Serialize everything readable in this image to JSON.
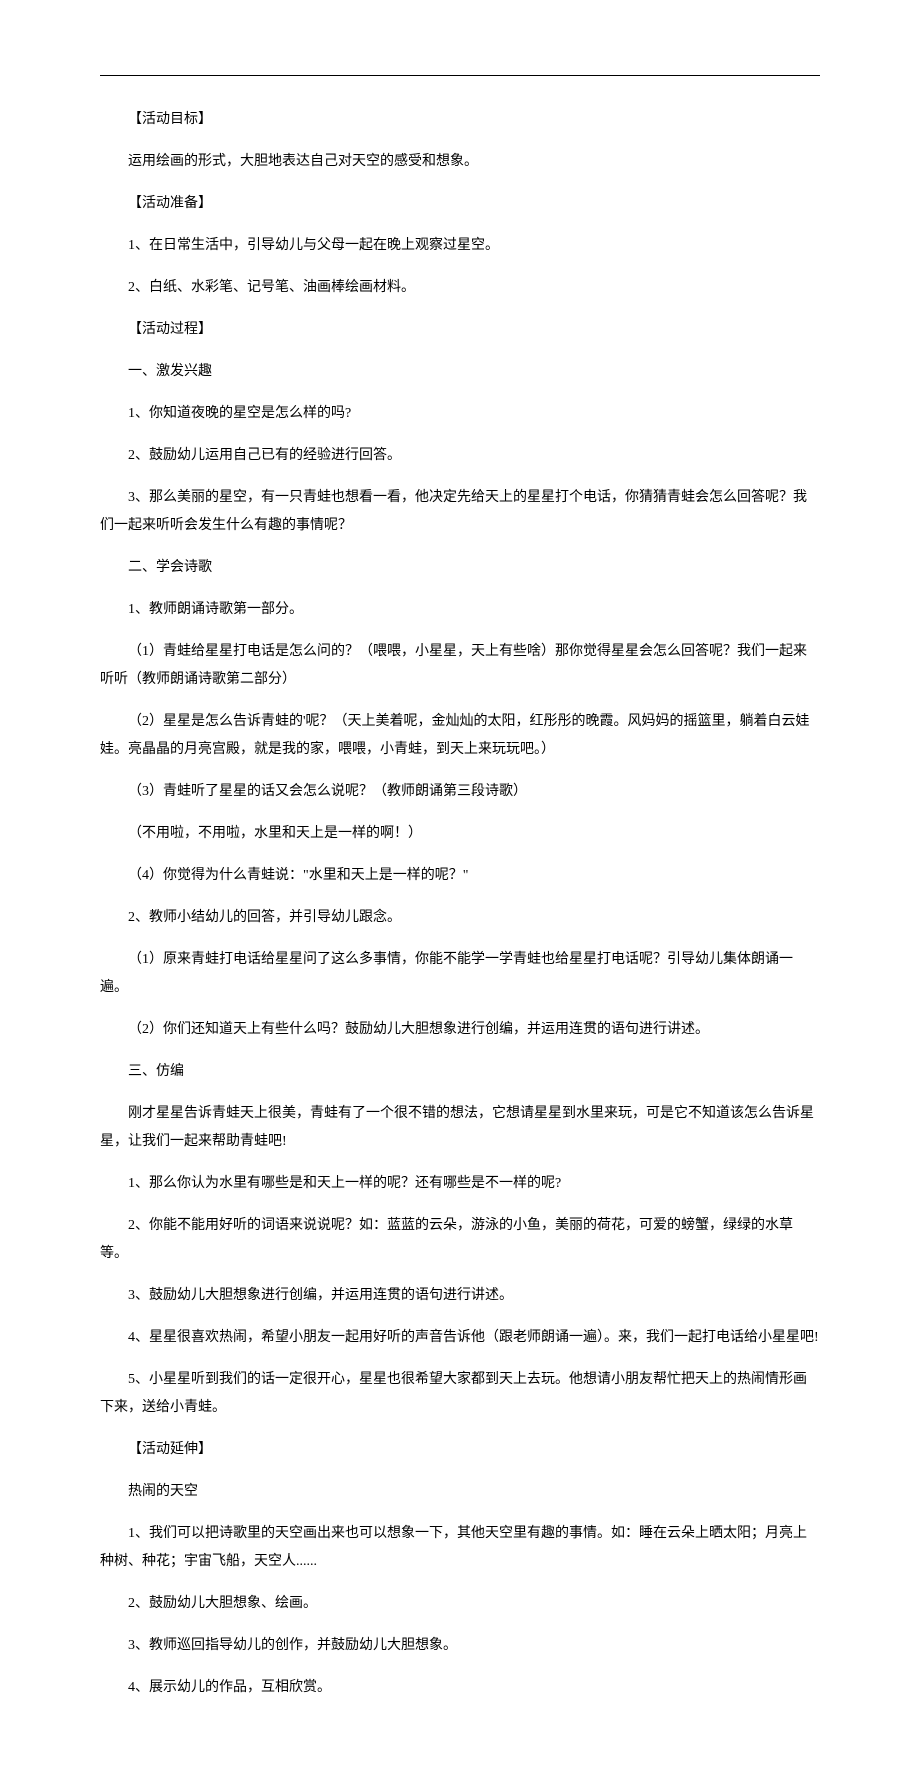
{
  "lines": [
    "【活动目标】",
    "运用绘画的形式，大胆地表达自己对天空的感受和想象。",
    "【活动准备】",
    "1、在日常生活中，引导幼儿与父母一起在晚上观察过星空。",
    "2、白纸、水彩笔、记号笔、油画棒绘画材料。",
    "【活动过程】",
    "一、激发兴趣",
    "1、你知道夜晚的星空是怎么样的吗?",
    "2、鼓励幼儿运用自己已有的经验进行回答。"
  ],
  "para1": "3、那么美丽的星空，有一只青蛙也想看一看，他决定先给天上的星星打个电话，你猜猜青蛙会怎么回答呢？我们一起来听听会发生什么有趣的事情呢？",
  "lines2": [
    "二、学会诗歌",
    "1、教师朗诵诗歌第一部分。"
  ],
  "para2": "（1）青蛙给星星打电话是怎么问的？（喂喂，小星星，天上有些啥）那你觉得星星会怎么回答呢？我们一起来听听（教师朗诵诗歌第二部分）",
  "para3": "（2）星星是怎么告诉青蛙的'呢？（天上美着呢，金灿灿的太阳，红彤彤的晚霞。风妈妈的摇篮里，躺着白云娃娃。亮晶晶的月亮宫殿，就是我的家，喂喂，小青蛙，到天上来玩玩吧。）",
  "lines3": [
    "（3）青蛙听了星星的话又会怎么说呢？（教师朗诵第三段诗歌）",
    "（不用啦，不用啦，水里和天上是一样的啊！）",
    "（4）你觉得为什么青蛙说：\"水里和天上是一样的呢？\"",
    "2、教师小结幼儿的回答，并引导幼儿跟念。",
    "（1）原来青蛙打电话给星星问了这么多事情，你能不能学一学青蛙也给星星打电话呢？引导幼儿集体朗诵一遍。",
    "（2）你们还知道天上有些什么吗？鼓励幼儿大胆想象进行创编，并运用连贯的语句进行讲述。",
    "三、仿编"
  ],
  "para4": "刚才星星告诉青蛙天上很美，青蛙有了一个很不错的想法，它想请星星到水里来玩，可是它不知道该怎么告诉星星，让我们一起来帮助青蛙吧!",
  "lines4": [
    "1、那么你认为水里有哪些是和天上一样的呢？还有哪些是不一样的呢?",
    "2、你能不能用好听的词语来说说呢？如：蓝蓝的云朵，游泳的小鱼，美丽的荷花，可爱的螃蟹，绿绿的水草等。",
    "3、鼓励幼儿大胆想象进行创编，并运用连贯的语句进行讲述。",
    "4、星星很喜欢热闹，希望小朋友一起用好听的声音告诉他（跟老师朗诵一遍）。来，我们一起打电话给小星星吧!"
  ],
  "para5": "5、小星星听到我们的话一定很开心，星星也很希望大家都到天上去玩。他想请小朋友帮忙把天上的热闹情形画下来，送给小青蛙。",
  "lines5": [
    "【活动延伸】",
    "热闹的天空"
  ],
  "para6": "1、我们可以把诗歌里的天空画出来也可以想象一下，其他天空里有趣的事情。如：睡在云朵上晒太阳；月亮上种树、种花；宇宙飞船，天空人......",
  "lines6": [
    "2、鼓励幼儿大胆想象、绘画。",
    "3、教师巡回指导幼儿的创作，并鼓励幼儿大胆想象。",
    "4、展示幼儿的作品，互相欣赏。"
  ]
}
